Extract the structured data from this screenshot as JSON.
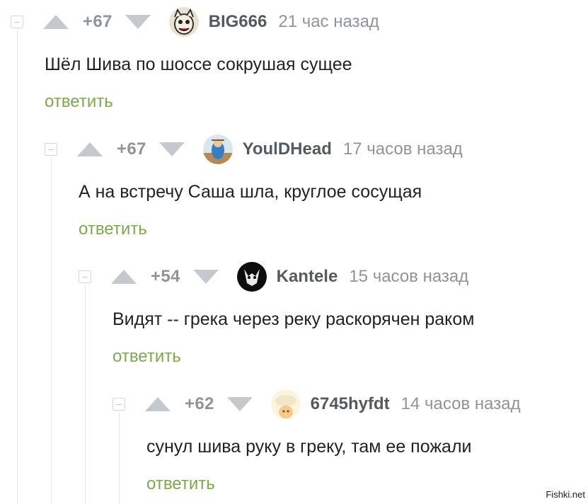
{
  "comments": [
    {
      "rating": "+67",
      "username": "BIG666",
      "time": "21 час назад",
      "text": "Шёл Шива по шоссе сокрушая сущее",
      "reply_label": "ответить",
      "avatar_icon": "cartoon-avatar-icon"
    },
    {
      "rating": "+67",
      "username": "YoulDHead",
      "time": "17 часов назад",
      "text": "А на встречу Саша шла, круглое сосущая",
      "reply_label": "ответить",
      "avatar_icon": "painting-avatar-icon"
    },
    {
      "rating": "+54",
      "username": "Kantele",
      "time": "15 часов назад",
      "text": "Видят -- грека через реку раскорячен раком",
      "reply_label": "ответить",
      "avatar_icon": "dark-face-avatar-icon"
    },
    {
      "rating": "+62",
      "username": "6745hyfdt",
      "time": "14 часов назад",
      "text": "сунул шива руку в греку, там ее пожали",
      "reply_label": "ответить",
      "avatar_icon": "cat-avatar-icon"
    }
  ],
  "watermark": "Fishki.net",
  "colors": {
    "reply_green": "#7ea850",
    "meta_gray": "#8f9499",
    "username_gray": "#555a5f",
    "arrow_gray": "#c5c9cd"
  }
}
